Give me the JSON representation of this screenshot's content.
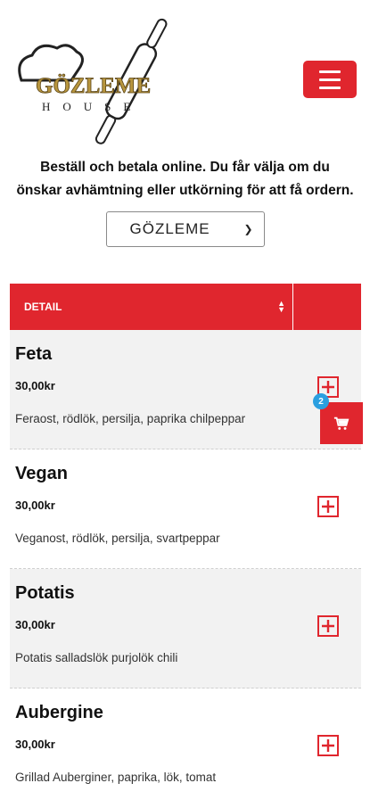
{
  "header": {
    "logo_text": "GÖZLEME",
    "logo_subtext": "HOUSE",
    "menu_icon": "hamburger-icon"
  },
  "intro_text": "Beställ och betala online. Du får välja om du önskar avhämtning eller utkörning för att få ordern.",
  "category_select": {
    "selected": "GÖZLEME"
  },
  "table": {
    "header_detail": "DETAIL"
  },
  "cart": {
    "count": "2",
    "icon": "cart-icon"
  },
  "items": [
    {
      "name": "Feta",
      "price": "30,00kr",
      "description": "Feraost, rödlök, persilja, paprika chilpeppar"
    },
    {
      "name": "Vegan",
      "price": "30,00kr",
      "description": "Veganost, rödlök, persilja, svartpeppar"
    },
    {
      "name": "Potatis",
      "price": "30,00kr",
      "description": "Potatis salladslök purjolök chili"
    },
    {
      "name": "Aubergine",
      "price": "30,00kr",
      "description": "Grillad Auberginer, paprika, lök, tomat"
    }
  ],
  "colors": {
    "accent": "#e0262e",
    "badge": "#2b9fe0",
    "logo_gold": "#b8963e"
  }
}
